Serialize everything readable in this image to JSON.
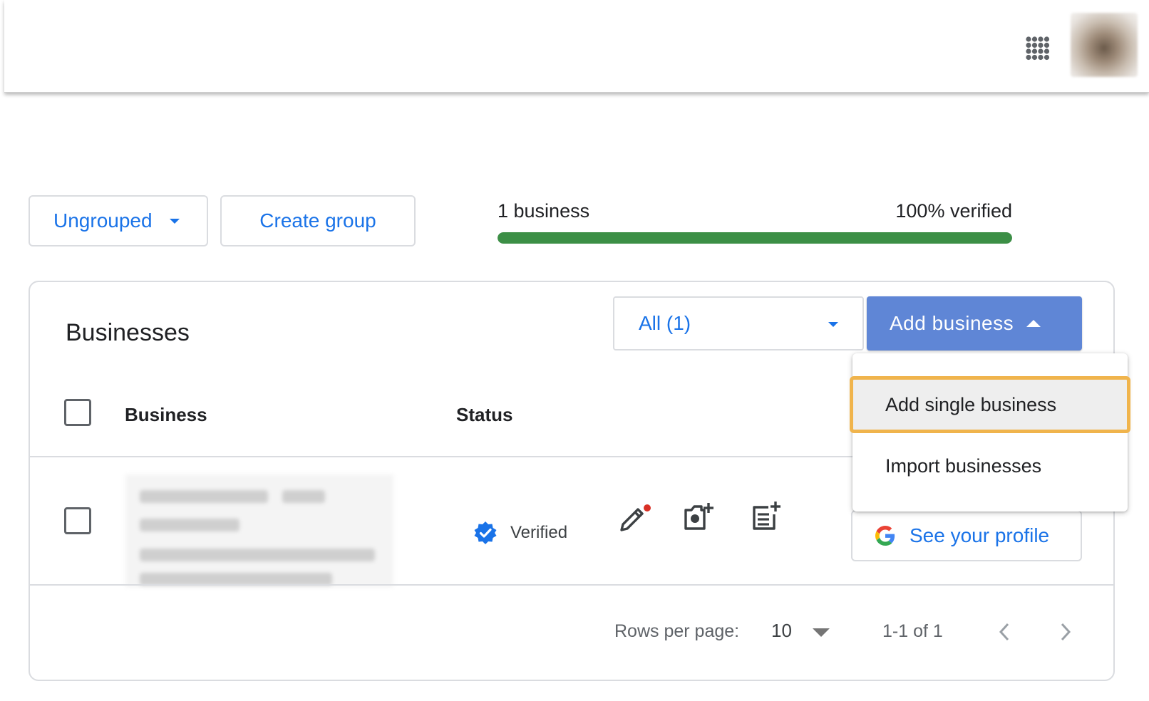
{
  "header": {
    "apps_icon": "apps-grid-icon",
    "avatar": "account-avatar"
  },
  "toolbar": {
    "group_select_label": "Ungrouped",
    "create_group_label": "Create group"
  },
  "summary": {
    "business_count": "1 business",
    "verified_label": "100% verified",
    "verified_progress": 1.0,
    "progress_color": "#3c8f46"
  },
  "card": {
    "title": "Businesses",
    "filter_value": "All (1)",
    "add_business_label": "Add business",
    "columns": {
      "business": "Business",
      "status": "Status"
    },
    "rows": [
      {
        "status": "Verified",
        "actions": [
          "edit-profile-icon",
          "add-photo-icon",
          "add-post-icon"
        ],
        "profile_button": "See your profile"
      }
    ],
    "pagination": {
      "rows_per_page_label": "Rows per page:",
      "rows_per_page_value": "10",
      "range": "1-1 of 1"
    }
  },
  "dropdown_menu": {
    "items": [
      "Add single business",
      "Import businesses"
    ]
  },
  "colors": {
    "accent": "#1a73e8",
    "primary_button": "#5f86d6",
    "highlight_border": "#f0b44c",
    "verified_badge": "#1a73e8"
  }
}
